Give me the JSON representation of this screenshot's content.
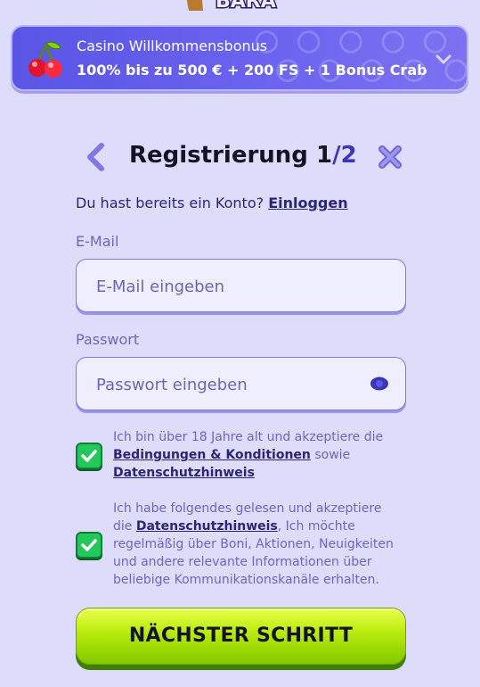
{
  "logo": {
    "text": "BARA"
  },
  "bonus": {
    "line1": "Casino Willkommensbonus",
    "line2": "100% bis zu 500 € + 200 FS + 1 Bonus Crab",
    "icon": "cherry-icon",
    "toggle_icon": "chevron-down-icon"
  },
  "header": {
    "title": "Registrierung",
    "step_current": "1",
    "step_total": "2",
    "back_icon": "chevron-left-icon",
    "close_icon": "close-icon"
  },
  "login": {
    "prompt": "Du hast bereits ein Konto?",
    "link": "Einloggen"
  },
  "form": {
    "email": {
      "label": "E-Mail",
      "placeholder": "E-Mail eingeben",
      "value": ""
    },
    "password": {
      "label": "Passwort",
      "placeholder": "Passwort eingeben",
      "value": "",
      "toggle_icon": "eye-icon"
    }
  },
  "consents": [
    {
      "checked": true,
      "text_before": "Ich bin über 18 Jahre alt und akzeptiere die",
      "link1": "Bedingungen & Konditionen",
      "text_middle": "sowie",
      "link2": "Datenschutzhinweis"
    },
    {
      "checked": true,
      "text_before": "Ich habe folgendes gelesen und akzeptiere die",
      "link1": "Datenschutzhinweis",
      "text_after": ", Ich möchte regelmäßig über Boni, Aktionen, Neuigkeiten und andere relevante Informationen über beliebige Kommunikationskanäle erhalten."
    }
  ],
  "actions": {
    "next_label": "NÄCHSTER SCHRITT"
  },
  "colors": {
    "background": "#dedcfb",
    "banner": "#6a63ee",
    "accent": "#3b35b8",
    "button": "#b7ea0c",
    "checkbox": "#24c85a"
  }
}
